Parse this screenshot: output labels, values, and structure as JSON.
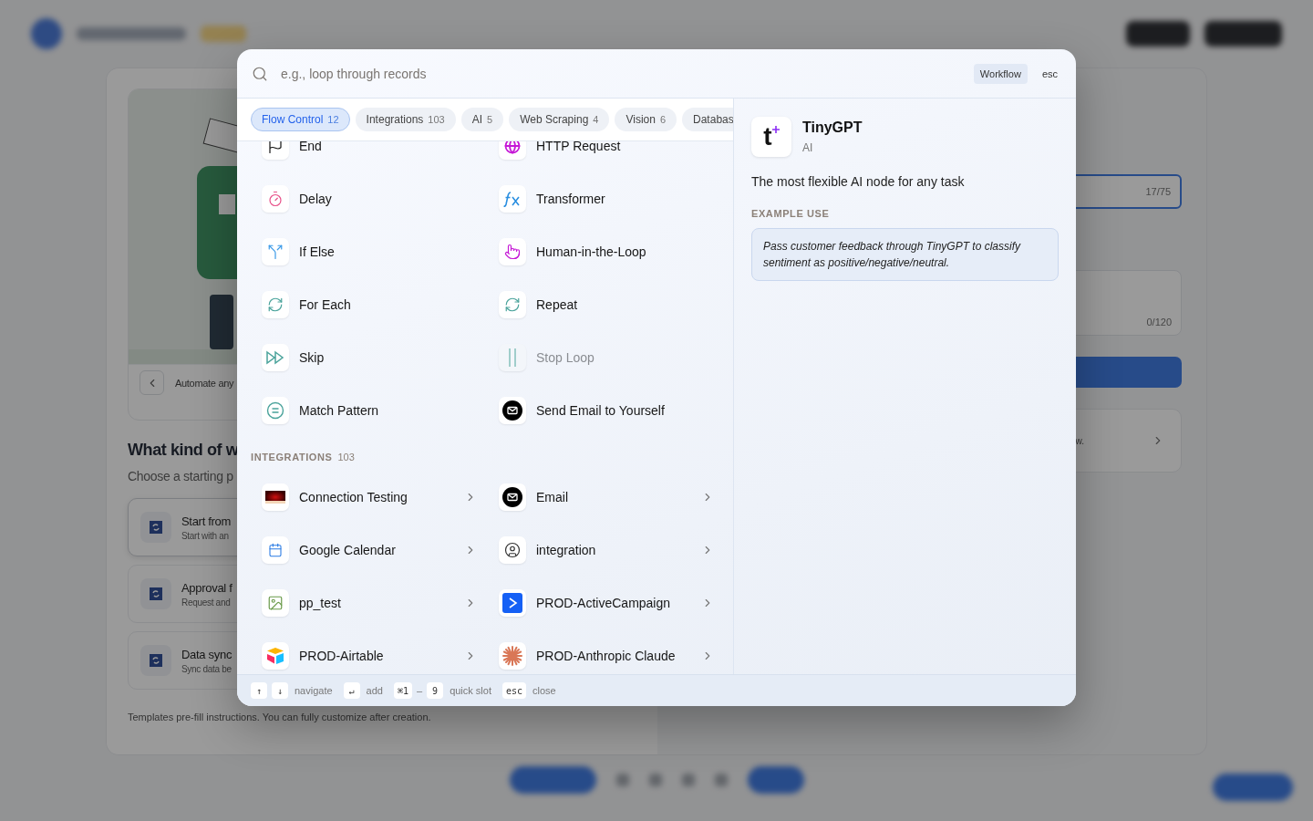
{
  "background": {
    "intro": {
      "caption": "Automate any"
    },
    "heading": "What kind of w",
    "subtitle": "Choose a starting p",
    "options": [
      {
        "title": "Start from",
        "subtitle": "Start with an",
        "selected": true
      },
      {
        "title": "Approval f",
        "subtitle": "Request and",
        "selected": false
      },
      {
        "title": "Data sync",
        "subtitle": "Sync data be",
        "selected": false
      }
    ],
    "note": "Templates pre-fill instructions. You can fully customize after creation.",
    "name_counter": "17/75",
    "description_counter": "0/120",
    "card_text": "w."
  },
  "palette": {
    "search": {
      "placeholder": "e.g., loop through records"
    },
    "scope": "Workflow",
    "close_hint": "esc",
    "tabs": [
      {
        "label": "Flow Control",
        "count": "12",
        "selected": true
      },
      {
        "label": "Integrations",
        "count": "103",
        "selected": false
      },
      {
        "label": "AI",
        "count": "5",
        "selected": false
      },
      {
        "label": "Web Scraping",
        "count": "4",
        "selected": false
      },
      {
        "label": "Vision",
        "count": "6",
        "selected": false
      },
      {
        "label": "Databas",
        "selected": false
      }
    ],
    "flow_control": [
      {
        "label": "End",
        "disabled": false
      },
      {
        "label": "HTTP Request",
        "disabled": false
      },
      {
        "label": "Delay",
        "disabled": false
      },
      {
        "label": "Transformer",
        "disabled": false
      },
      {
        "label": "If Else",
        "disabled": false
      },
      {
        "label": "Human-in-the-Loop",
        "disabled": false
      },
      {
        "label": "For Each",
        "disabled": false
      },
      {
        "label": "Repeat",
        "disabled": false
      },
      {
        "label": "Skip",
        "disabled": false
      },
      {
        "label": "Stop Loop",
        "disabled": true
      },
      {
        "label": "Match Pattern",
        "disabled": false
      },
      {
        "label": "Send Email to Yourself",
        "disabled": false
      }
    ],
    "integrations": {
      "title": "INTEGRATIONS",
      "count": "103",
      "items": [
        {
          "label": "Connection Testing"
        },
        {
          "label": "Email"
        },
        {
          "label": "Google Calendar"
        },
        {
          "label": "integration"
        },
        {
          "label": "pp_test"
        },
        {
          "label": "PROD-ActiveCampaign"
        },
        {
          "label": "PROD-Airtable"
        },
        {
          "label": "PROD-Anthropic Claude"
        }
      ]
    },
    "detail": {
      "logo_letter": "t",
      "title": "TinyGPT",
      "category": "AI",
      "description": "The most flexible AI node for any task",
      "example_heading": "EXAMPLE USE",
      "example": "Pass customer feedback through TinyGPT to classify sentiment as positive/negative/neutral."
    },
    "footer": [
      {
        "keys": [
          "↑",
          "↓"
        ],
        "label": "navigate"
      },
      {
        "keys": [
          "↵"
        ],
        "label": "add"
      },
      {
        "keys": [
          "⌘1",
          "9"
        ],
        "separator": "–",
        "label": "quick slot"
      },
      {
        "keys": [
          "esc"
        ],
        "label": "close"
      }
    ]
  }
}
